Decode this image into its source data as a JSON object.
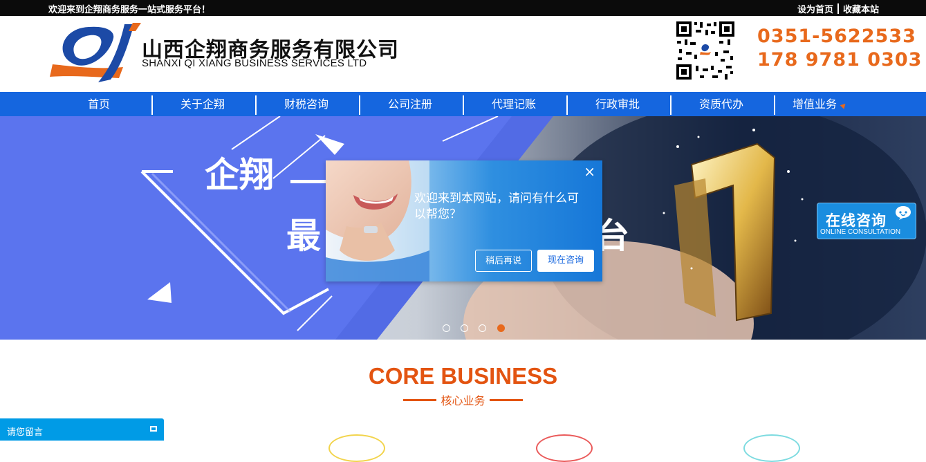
{
  "topbar": {
    "welcome": "欢迎来到企翔商务服务一站式服务平台！",
    "set_home": "设为首页",
    "bookmark": "收藏本站"
  },
  "header": {
    "company_cn": "山西企翔商务服务有限公司",
    "company_en": "SHANXI QI XIANG BUSINESS SERVICES LTD",
    "phone1": "0351-5622533",
    "phone2": "178 9781 0303"
  },
  "nav": {
    "items": [
      "首页",
      "关于企翔",
      "财税咨询",
      "公司注册",
      "代理记账",
      "行政审批",
      "资质代办",
      "增值业务"
    ]
  },
  "banner": {
    "headline_1": "企翔",
    "headline_2": "最",
    "headline_3": "台",
    "slides": 4,
    "active_slide": 4
  },
  "popup": {
    "message": "欢迎来到本网站，请问有什么可以帮您？",
    "later_label": "稍后再说",
    "now_label": "现在咨询",
    "close_glyph": "×"
  },
  "consult": {
    "title": "在线咨询",
    "subtitle": "ONLINE CONSULTATION"
  },
  "core": {
    "title": "CORE BUSINESS",
    "subtitle": "核心业务"
  },
  "message_bar": {
    "label": "请您留言"
  },
  "colors": {
    "nav_blue": "#1566df",
    "accent_orange": "#e8691c",
    "banner_blue": "#5b74ee"
  }
}
